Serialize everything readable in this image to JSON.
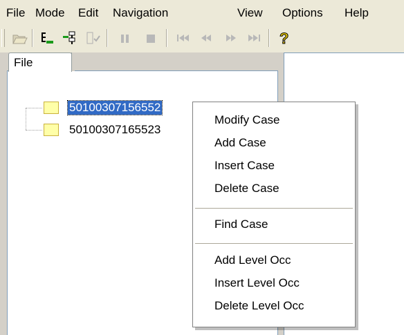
{
  "menubar": {
    "items": [
      "File",
      "Mode",
      "Edit",
      "Navigation",
      "View",
      "Options",
      "Help"
    ]
  },
  "toolbar": {
    "buttons": [
      "open-folder-icon",
      "tree-add-icon",
      "tree-insert-icon",
      "checklist-icon",
      "pause-icon",
      "stop-icon",
      "first-icon",
      "previous-icon",
      "next-icon",
      "last-icon",
      "help-icon"
    ]
  },
  "tab": {
    "label": "File"
  },
  "tree": {
    "nodes": [
      {
        "label": "50100307156552",
        "selected": true
      },
      {
        "label": "50100307165523",
        "selected": false
      }
    ]
  },
  "context_menu": {
    "groups": [
      [
        "Modify Case",
        "Add Case",
        "Insert Case",
        "Delete Case"
      ],
      [
        "Find Case"
      ],
      [
        "Add Level Occ",
        "Insert Level Occ",
        "Delete Level Occ"
      ]
    ]
  }
}
